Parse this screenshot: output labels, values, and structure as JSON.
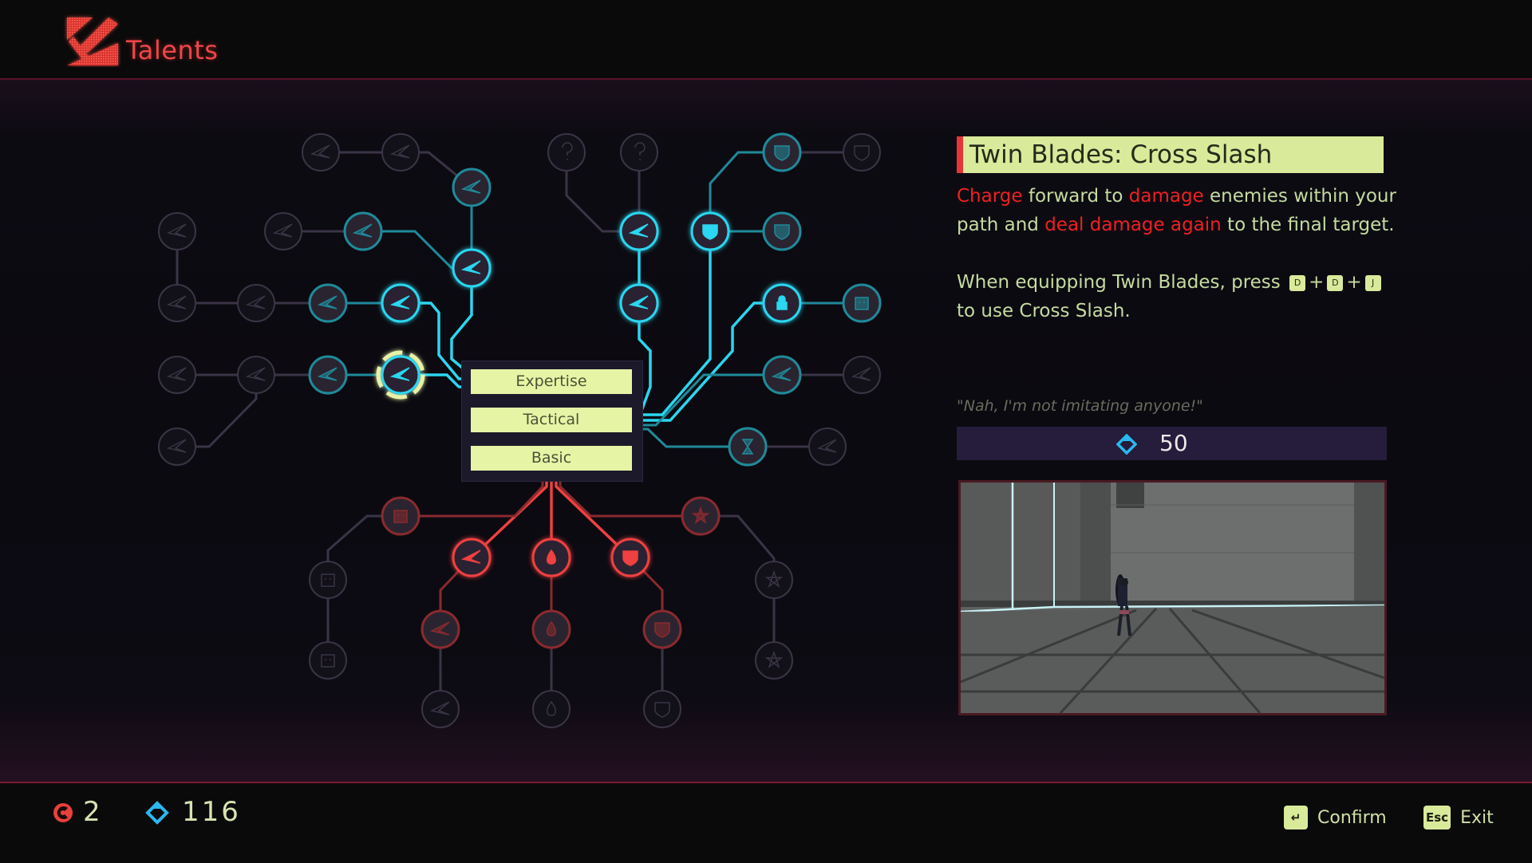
{
  "header": {
    "title": "Talents",
    "logo_icon": "talent-emblem-icon"
  },
  "menu": {
    "items": [
      {
        "label": "Expertise",
        "state": "active"
      },
      {
        "label": "Tactical",
        "state": "active"
      },
      {
        "label": "Basic",
        "state": "active"
      }
    ]
  },
  "tree": {
    "colors": {
      "cyan_active": "#2bd6f0",
      "cyan_dim": "#1f8a9a",
      "red_active": "#f0403f",
      "red_dim": "#8a2a2e",
      "locked": "#3a3446",
      "selected_ring": "#e8f1a4"
    },
    "nodes": [
      {
        "id": "l1",
        "icon": "swift-blade-icon",
        "state": "locked"
      },
      {
        "id": "l2",
        "icon": "vortex-icon",
        "state": "locked"
      },
      {
        "id": "l3",
        "icon": "triple-blade-icon",
        "state": "dim"
      },
      {
        "id": "l4",
        "icon": "compass-icon",
        "state": "locked"
      },
      {
        "id": "l5",
        "icon": "crown-burst-icon",
        "state": "locked"
      },
      {
        "id": "l6",
        "icon": "crown-burst-icon",
        "state": "dim"
      },
      {
        "id": "l7",
        "icon": "crescent-strike-icon",
        "state": "active"
      },
      {
        "id": "l8",
        "icon": "compass-icon",
        "state": "locked"
      },
      {
        "id": "l9",
        "icon": "arc-slash-icon",
        "state": "locked"
      },
      {
        "id": "l10",
        "icon": "hook-blade-icon",
        "state": "dim"
      },
      {
        "id": "l11",
        "icon": "dash-blade-icon",
        "state": "active"
      },
      {
        "id": "l12",
        "icon": "horizontal-blades-icon",
        "state": "locked"
      },
      {
        "id": "l13",
        "icon": "spiral-blades-icon",
        "state": "locked"
      },
      {
        "id": "l14",
        "icon": "twin-blades-icon",
        "state": "dim"
      },
      {
        "id": "l15",
        "icon": "cross-slash-icon",
        "state": "selected"
      },
      {
        "id": "l16",
        "icon": "pinwheel-icon",
        "state": "locked"
      },
      {
        "id": "r1",
        "icon": "question-mark-icon",
        "state": "locked"
      },
      {
        "id": "r2",
        "icon": "question-mark-icon",
        "state": "locked"
      },
      {
        "id": "r3",
        "icon": "shield-strike-icon",
        "state": "dim"
      },
      {
        "id": "r4",
        "icon": "shattered-shield-icon",
        "state": "locked"
      },
      {
        "id": "r5",
        "icon": "med-card-icon",
        "state": "active"
      },
      {
        "id": "r6",
        "icon": "arrow-shield-icon",
        "state": "active"
      },
      {
        "id": "r7",
        "icon": "guard-shield-icon",
        "state": "dim"
      },
      {
        "id": "r8",
        "icon": "stopwatch-ammo-icon",
        "state": "active"
      },
      {
        "id": "r9",
        "icon": "lock-reload-icon",
        "state": "active"
      },
      {
        "id": "r10",
        "icon": "cube-icon",
        "state": "dim"
      },
      {
        "id": "r11",
        "icon": "shard-burst-icon",
        "state": "dim"
      },
      {
        "id": "r12",
        "icon": "shard-burst-icon",
        "state": "locked"
      },
      {
        "id": "r13",
        "icon": "hourglass-icon",
        "state": "dim"
      },
      {
        "id": "r14",
        "icon": "upgrade-arrow-icon",
        "state": "locked"
      },
      {
        "id": "b1",
        "icon": "backpack-icon",
        "state": "dim"
      },
      {
        "id": "b2",
        "icon": "star-target-icon",
        "state": "dim"
      },
      {
        "id": "b3",
        "icon": "slash-blade-icon",
        "state": "active"
      },
      {
        "id": "b4",
        "icon": "blood-drop-icon",
        "state": "active"
      },
      {
        "id": "b5",
        "icon": "power-shield-icon",
        "state": "active"
      },
      {
        "id": "b6",
        "icon": "robot-icon",
        "state": "locked"
      },
      {
        "id": "b7",
        "icon": "pentagram-icon",
        "state": "locked"
      },
      {
        "id": "b8",
        "icon": "slash-blade-icon",
        "state": "dim"
      },
      {
        "id": "b9",
        "icon": "blood-drops-icon",
        "state": "dim"
      },
      {
        "id": "b10",
        "icon": "laurel-shield-icon",
        "state": "dim"
      },
      {
        "id": "b11",
        "icon": "robot-icon",
        "state": "locked"
      },
      {
        "id": "b12",
        "icon": "hexagram-icon",
        "state": "locked"
      },
      {
        "id": "b13",
        "icon": "slash-blade-icon",
        "state": "locked"
      },
      {
        "id": "b14",
        "icon": "blood-drops-icon",
        "state": "locked"
      },
      {
        "id": "b15",
        "icon": "triple-shield-icon",
        "state": "locked"
      }
    ]
  },
  "detail": {
    "title": "Twin Blades: Cross Slash",
    "desc_parts": [
      {
        "text": "Charge",
        "hl": true
      },
      {
        "text": " forward to ",
        "hl": false
      },
      {
        "text": "damage",
        "hl": true
      },
      {
        "text": " enemies within your path and ",
        "hl": false
      },
      {
        "text": "deal damage again",
        "hl": true
      },
      {
        "text": " to the final target.",
        "hl": false
      }
    ],
    "usage_prefix": "When equipping Twin Blades, press",
    "keys": [
      "D",
      "D",
      "J"
    ],
    "key_joiner": "+",
    "usage_suffix": "to use Cross Slash.",
    "quote": "\"Nah, I'm not imitating anyone!\"",
    "cost": "50",
    "cost_icon": "crystal-diamond-icon",
    "preview_alt": "skill preview video of character in grey training room"
  },
  "footer": {
    "tokens": {
      "icon": "talent-token-icon",
      "value": "2"
    },
    "crystals": {
      "icon": "crystal-diamond-icon",
      "value": "116"
    },
    "confirm": {
      "key": "↵",
      "label": "Confirm"
    },
    "exit": {
      "key": "Esc",
      "label": "Exit"
    }
  }
}
